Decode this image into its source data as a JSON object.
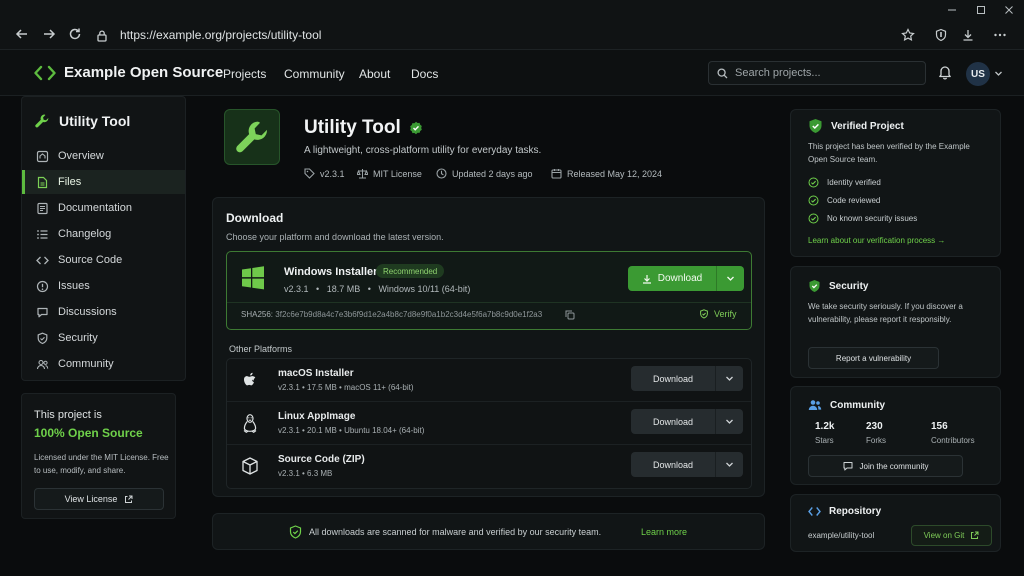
{
  "browser": {
    "url": "https://example.org/projects/utility-tool"
  },
  "site": {
    "brand": "Example Open Source",
    "nav": [
      "Projects",
      "Community",
      "About",
      "Docs"
    ],
    "search_placeholder": "Search projects...",
    "avatar_initials": "US"
  },
  "sidebar": {
    "title": "Utility Tool",
    "items": [
      {
        "label": "Overview",
        "icon": "home-icon"
      },
      {
        "label": "Files",
        "icon": "file-icon",
        "active": true
      },
      {
        "label": "Documentation",
        "icon": "doc-icon"
      },
      {
        "label": "Changelog",
        "icon": "list-icon"
      },
      {
        "label": "Source Code",
        "icon": "code-icon"
      },
      {
        "label": "Issues",
        "icon": "alert-icon"
      },
      {
        "label": "Discussions",
        "icon": "chat-icon"
      },
      {
        "label": "Security",
        "icon": "shield-icon"
      },
      {
        "label": "Community",
        "icon": "users-icon"
      }
    ],
    "license_box": {
      "line1": "This project is",
      "line2": "100% Open Source",
      "text": "Licensed under the MIT License. Free to use, modify, and share.",
      "button": "View License"
    }
  },
  "project": {
    "title": "Utility Tool",
    "description": "A lightweight, cross-platform utility for everyday tasks.",
    "version": "v2.3.1",
    "license": "MIT License",
    "updated": "Updated 2 days ago",
    "released": "Released May 12, 2024"
  },
  "download": {
    "title": "Download",
    "subtitle": "Choose your platform and download the latest version.",
    "primary": {
      "name": "Windows Installer",
      "badge": "Recommended",
      "version": "v2.3.1",
      "size": "18.7 MB",
      "os": "Windows 10/11 (64-bit)",
      "sha_label": "SHA256:",
      "sha": "3f2c6e7b9d8a4c7e3b6f9d1e2a4b8c7d8e9f0a1b2c3d4e5f6a7b8c9d0e1f2a3",
      "button": "Download",
      "verify": "Verify"
    },
    "other_title": "Other Platforms",
    "others": [
      {
        "name": "macOS Installer",
        "meta": "v2.3.1  •  17.5 MB  •  macOS 11+ (64-bit)",
        "button": "Download",
        "icon": "apple-icon"
      },
      {
        "name": "Linux AppImage",
        "meta": "v2.3.1  •  20.1 MB  •  Ubuntu 18.04+ (64-bit)",
        "button": "Download",
        "icon": "linux-icon"
      },
      {
        "name": "Source Code (ZIP)",
        "meta": "v2.3.1  •  6.3 MB",
        "button": "Download",
        "icon": "package-icon"
      }
    ],
    "scan_message": "All downloads are scanned for malware and verified by our security team.",
    "learn_more": "Learn more"
  },
  "verified": {
    "title": "Verified Project",
    "text": "This project has been verified by the Example Open Source team.",
    "checks": [
      "Identity verified",
      "Code reviewed",
      "No known security issues"
    ],
    "link": "Learn about our verification process →"
  },
  "security": {
    "title": "Security",
    "text": "We take security seriously. If you discover a vulnerability, please report it responsibly.",
    "button": "Report a vulnerability"
  },
  "community": {
    "title": "Community",
    "stats": [
      {
        "value": "1.2k",
        "label": "Stars"
      },
      {
        "value": "230",
        "label": "Forks"
      },
      {
        "value": "156",
        "label": "Contributors"
      }
    ],
    "button": "Join the community"
  },
  "repository": {
    "title": "Repository",
    "path": "example/utility-tool",
    "button": "View on Git"
  },
  "colors": {
    "accent": "#3b9a33",
    "accent_text": "#6fd14a",
    "background": "#0a0c0d"
  }
}
